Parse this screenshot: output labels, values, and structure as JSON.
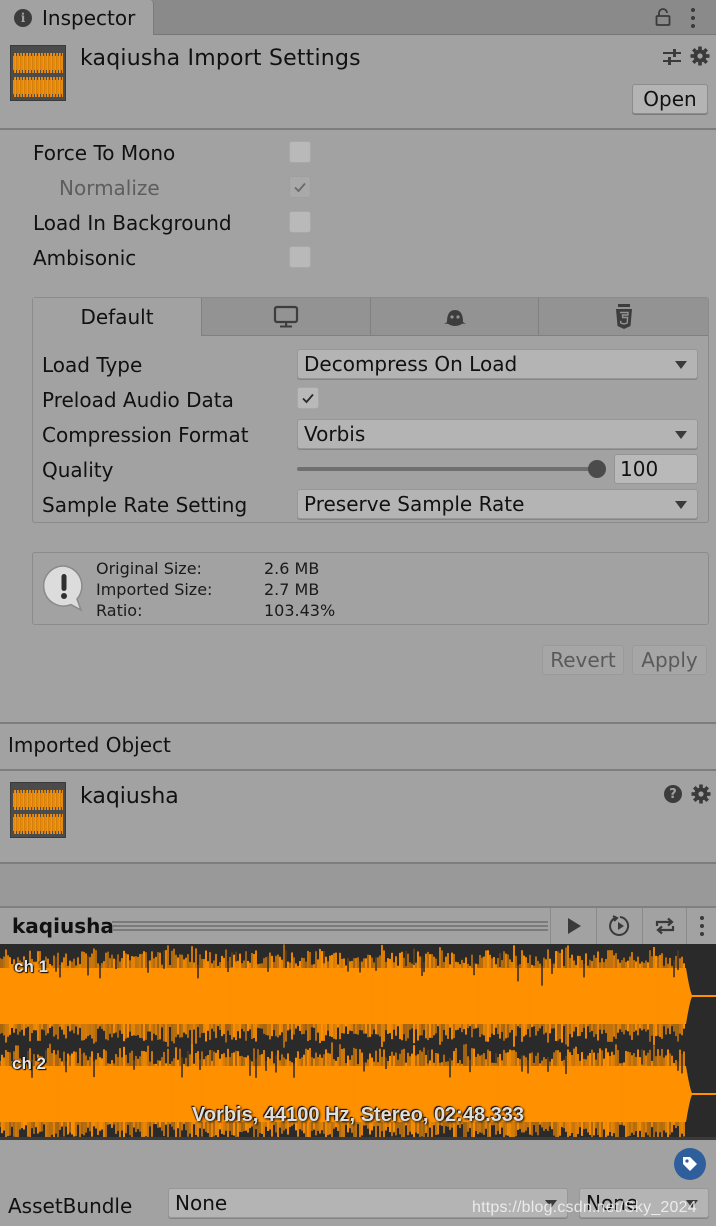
{
  "window": {
    "tab_label": "Inspector",
    "tab_icon": "info-icon",
    "lock_icon": "lock-open-icon",
    "menu_icon": "kebab-menu-icon"
  },
  "header": {
    "title": "kaqiusha Import Settings",
    "thumbnail_icon": "audio-clip-icon",
    "presets_icon": "sliders-icon",
    "settings_icon": "gear-icon",
    "open_label": "Open"
  },
  "options": [
    {
      "label": "Force To Mono",
      "checked": false,
      "enabled": true
    },
    {
      "label": "Normalize",
      "checked": true,
      "enabled": false
    },
    {
      "label": "Load In Background",
      "checked": false,
      "enabled": true
    },
    {
      "label": "Ambisonic",
      "checked": false,
      "enabled": true
    }
  ],
  "platform_tabs": [
    {
      "label": "Default",
      "icon": "",
      "active": true
    },
    {
      "label": "",
      "icon": "monitor-icon",
      "active": false
    },
    {
      "label": "",
      "icon": "android-robot-icon",
      "active": false
    },
    {
      "label": "",
      "icon": "html5-icon",
      "active": false
    }
  ],
  "platform_settings": {
    "load_type": {
      "label": "Load Type",
      "value": "Decompress On Load"
    },
    "preload": {
      "label": "Preload Audio Data",
      "checked": true
    },
    "compression": {
      "label": "Compression Format",
      "value": "Vorbis"
    },
    "quality": {
      "label": "Quality",
      "value": "100",
      "fraction": 1.0
    },
    "sample_rate": {
      "label": "Sample Rate Setting",
      "value": "Preserve Sample Rate"
    }
  },
  "info": {
    "icon": "warning-bubble-icon",
    "rows": [
      {
        "label": "Original Size:",
        "value": "2.6 MB"
      },
      {
        "label": "Imported Size:",
        "value": "2.7 MB"
      },
      {
        "label": "Ratio:",
        "value": "103.43%"
      }
    ]
  },
  "actions": {
    "revert_label": "Revert",
    "apply_label": "Apply"
  },
  "imported_object": {
    "section_title": "Imported Object",
    "name": "kaqiusha",
    "help_icon": "help-icon",
    "settings_icon": "gear-icon"
  },
  "preview": {
    "title": "kaqiusha",
    "play_icon": "play-icon",
    "autoplay_icon": "auto-play-icon",
    "loop_icon": "loop-icon",
    "menu_icon": "kebab-menu-icon",
    "channels": [
      "ch 1",
      "ch 2"
    ],
    "info": "Vorbis, 44100 Hz, Stereo, 02:48.333",
    "waveform_color": "#ff9000"
  },
  "footer": {
    "label_icon": "tag-icon",
    "assetbundle_label": "AssetBundle",
    "bundle_value": "None",
    "variant_value": "None",
    "watermark": "https://blog.csdn.net/Sky_2024"
  },
  "colors": {
    "panel_bg": "#a2a2a2",
    "accent_orange": "#ff9000",
    "tag_blue": "#2f5e9c"
  }
}
